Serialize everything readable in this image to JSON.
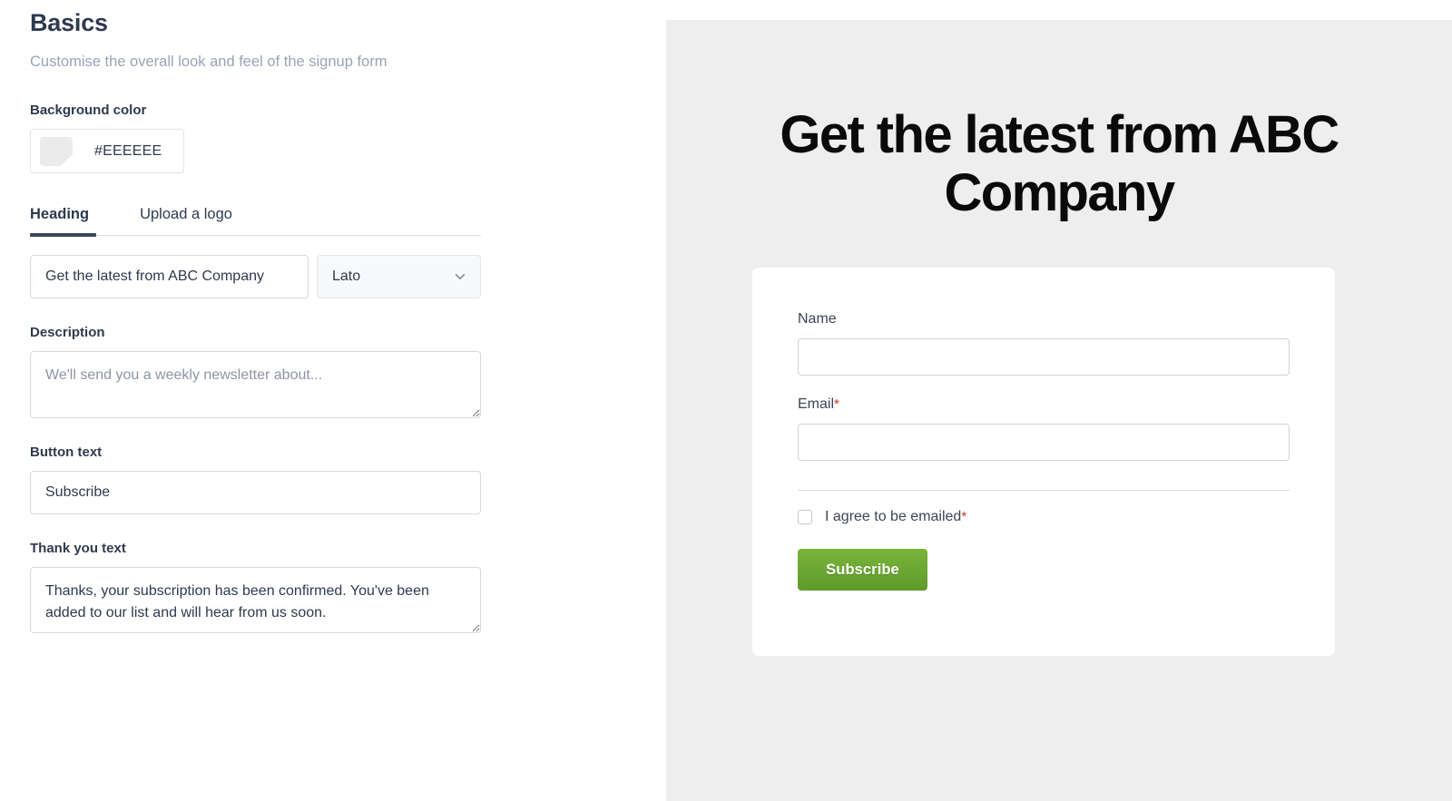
{
  "editor": {
    "section_title": "Basics",
    "section_subtitle": "Customise the overall look and feel of the signup form",
    "background_color": {
      "label": "Background color",
      "value": "#EEEEEE",
      "swatch_color": "#EEEEEE"
    },
    "tabs": [
      {
        "label": "Heading",
        "active": true
      },
      {
        "label": "Upload a logo",
        "active": false
      }
    ],
    "heading_input": {
      "value": "Get the latest from ABC Company",
      "placeholder": "Heading"
    },
    "font_select": {
      "value": "Lato",
      "icon": "chevron-down-icon"
    },
    "description": {
      "label": "Description",
      "value": "",
      "placeholder": "We'll send you a weekly newsletter about..."
    },
    "button_text": {
      "label": "Button text",
      "value": "Subscribe",
      "placeholder": "Button text"
    },
    "thank_you_text": {
      "label": "Thank you text",
      "value": "Thanks, your subscription has been confirmed. You've been added to our list and will hear from us soon.",
      "placeholder": "Thank you text"
    }
  },
  "preview": {
    "background_color": "#EEEEEE",
    "heading": "Get the latest from ABC Company",
    "form": {
      "name_label": "Name",
      "name_value": "",
      "email_label": "Email",
      "email_required_marker": "*",
      "email_value": "",
      "agree_label": "I agree to be emailed",
      "agree_required_marker": "*",
      "agree_checked": false,
      "submit_label": "Subscribe",
      "submit_color": "#6aa632"
    }
  }
}
